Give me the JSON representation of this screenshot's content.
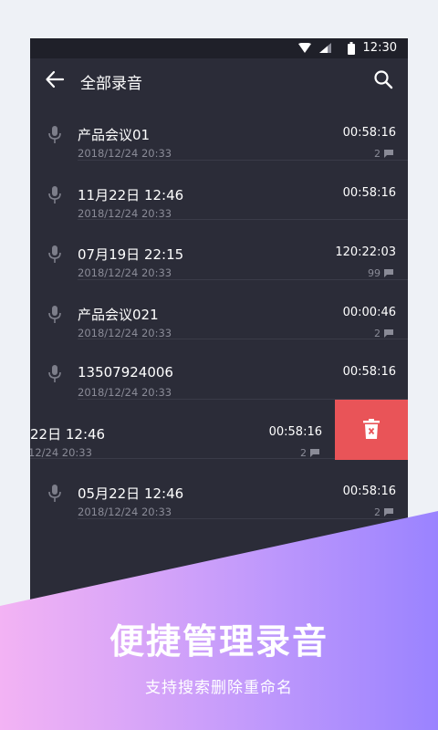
{
  "status_bar": {
    "time": "12:30",
    "icons": [
      "wifi-icon",
      "signal-icon",
      "battery-icon"
    ]
  },
  "app_bar": {
    "title": "全部录音",
    "back_icon": "arrow-left-icon",
    "search_icon": "search-icon"
  },
  "recordings": [
    {
      "name": "产品会议01",
      "date": "2018/12/24 20:33",
      "duration": "00:58:16",
      "count": "2"
    },
    {
      "name": "11月22日  12:46",
      "date": "2018/12/24 20:33",
      "duration": "00:58:16",
      "count": ""
    },
    {
      "name": "07月19日  22:15",
      "date": "2018/12/24 20:33",
      "duration": "120:22:03",
      "count": "99"
    },
    {
      "name": "产品会议021",
      "date": "2018/12/24 20:33",
      "duration": "00:00:46",
      "count": "2"
    },
    {
      "name": "13507924006",
      "date": "2018/12/24 20:33",
      "duration": "00:58:16",
      "count": ""
    },
    {
      "name": "22日  12:46",
      "date": "12/24 20:33",
      "duration": "00:58:16",
      "count": "2"
    },
    {
      "name": "05月22日  12:46",
      "date": "2018/12/24 20:33",
      "duration": "00:58:16",
      "count": "2"
    }
  ],
  "promo": {
    "headline": "便捷管理录音",
    "subline": "支持搜索删除重命名"
  },
  "colors": {
    "phone_bg": "#2b2c38",
    "delete_red": "#e95458",
    "gradient_start": "#f3b3f4",
    "gradient_end": "#9a83ff"
  }
}
